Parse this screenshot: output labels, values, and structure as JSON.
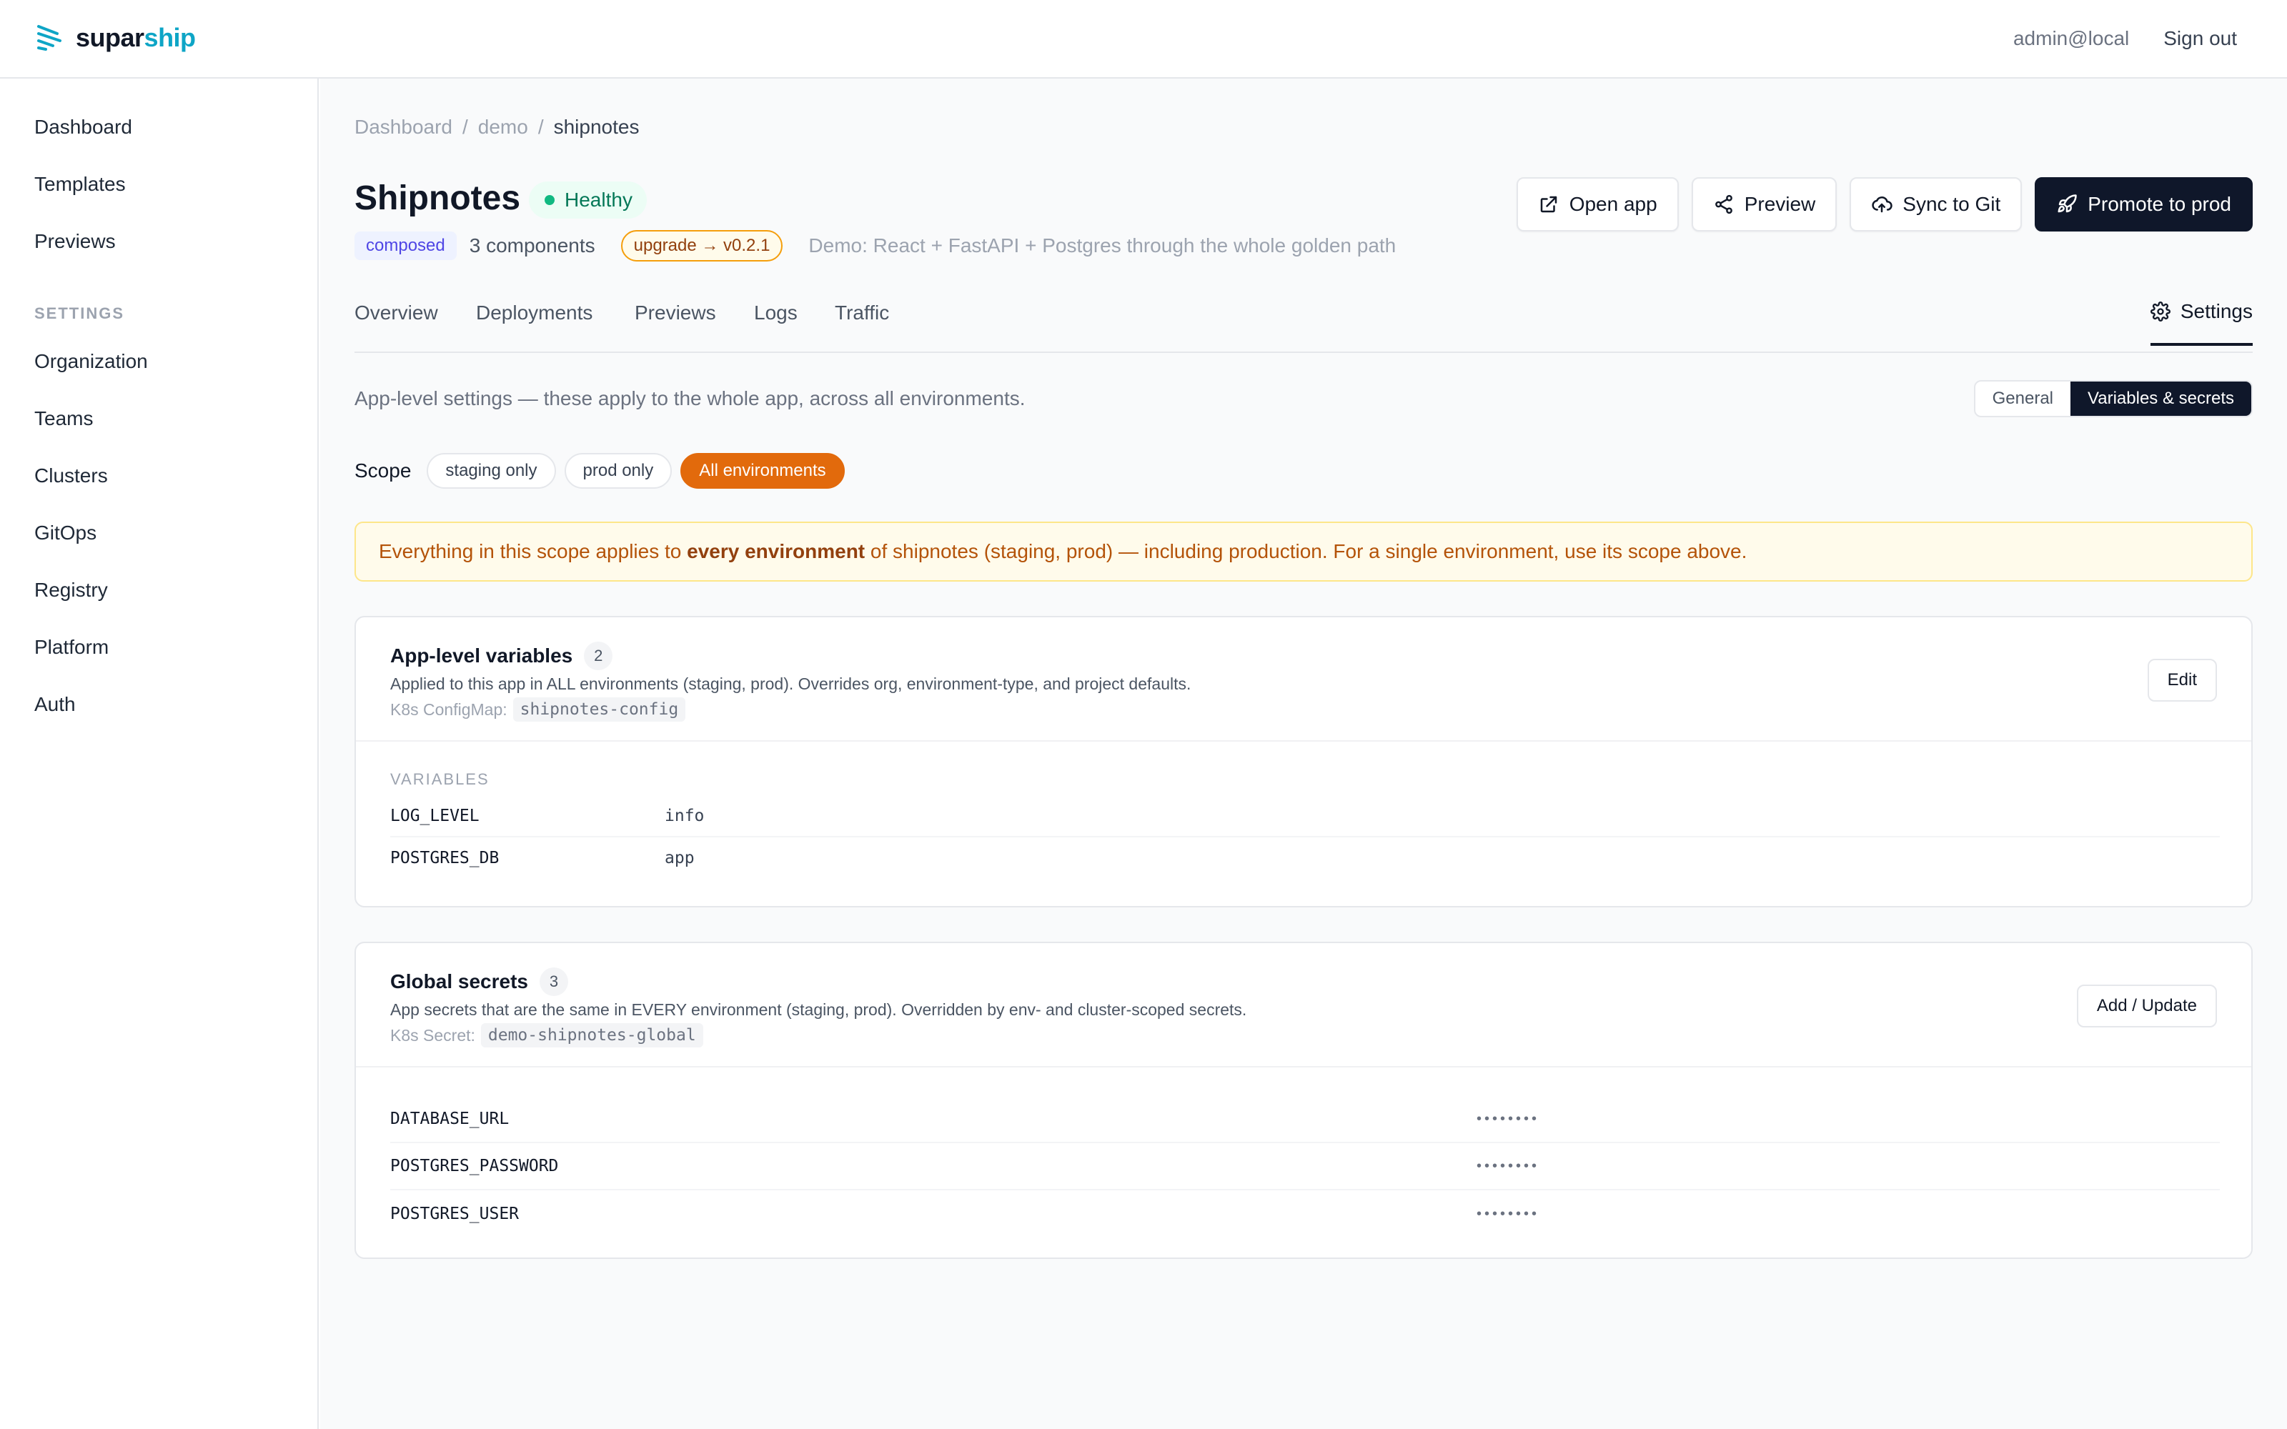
{
  "app": {
    "brand_prefix": "supar",
    "brand_suffix": "ship",
    "user": "admin@local",
    "signout_label": "Sign out"
  },
  "sidebar": {
    "items": [
      "Dashboard",
      "Templates",
      "Previews"
    ],
    "settings_heading": "SETTINGS",
    "settings_items": [
      "Organization",
      "Teams",
      "Clusters",
      "GitOps",
      "Registry",
      "Platform",
      "Auth"
    ]
  },
  "breadcrumb": [
    "Dashboard",
    "demo",
    "shipnotes"
  ],
  "page": {
    "title": "Shipnotes",
    "health": "Healthy",
    "tag": "composed",
    "components": "3 components",
    "upgrade": "upgrade → v0.2.1",
    "description": "Demo: React + FastAPI + Postgres through the whole golden path"
  },
  "actions": {
    "open_app": "Open app",
    "preview": "Preview",
    "sync": "Sync to Git",
    "promote": "Promote to prod"
  },
  "tabs": [
    "Overview",
    "Deployments",
    "Previews",
    "Logs",
    "Traffic"
  ],
  "active_tab": "Settings",
  "settings": {
    "intro": "App-level settings — these apply to the whole app, across all environments.",
    "segments": [
      "General",
      "Variables & secrets"
    ],
    "active_segment": "Variables & secrets",
    "scope_label": "Scope",
    "scopes": [
      "staging only",
      "prod only",
      "All environments"
    ],
    "active_scope": "All environments",
    "warning_pre": "Everything in this scope applies to ",
    "warning_bold": "every environment",
    "warning_post": " of shipnotes (staging, prod) — including production. For a single environment, use its scope above."
  },
  "variables_card": {
    "title": "App-level variables",
    "count": "2",
    "subtitle": "Applied to this app in ALL environments (staging, prod). Overrides org, environment-type, and project defaults.",
    "resource_label": "K8s ConfigMap:",
    "resource_name": "shipnotes-config",
    "button": "Edit",
    "section_label": "VARIABLES",
    "rows": [
      {
        "key": "LOG_LEVEL",
        "value": "info"
      },
      {
        "key": "POSTGRES_DB",
        "value": "app"
      }
    ]
  },
  "secrets_card": {
    "title": "Global secrets",
    "count": "3",
    "subtitle": "App secrets that are the same in EVERY environment (staging, prod). Overridden by env- and cluster-scoped secrets.",
    "resource_label": "K8s Secret:",
    "resource_name": "demo-shipnotes-global",
    "button": "Add / Update",
    "rows": [
      {
        "key": "DATABASE_URL",
        "value": "••••••••"
      },
      {
        "key": "POSTGRES_PASSWORD",
        "value": "••••••••"
      },
      {
        "key": "POSTGRES_USER",
        "value": "••••••••"
      }
    ]
  },
  "colors": {
    "accent": "#0ea5c6",
    "primary_dark": "#0f172a",
    "scope_active": "#e26a0c",
    "healthy": "#10b981",
    "warning_bg": "#fffbeb"
  },
  "icons": [
    "logo-icon",
    "external-link-icon",
    "share-icon",
    "cloud-upload-icon",
    "rocket-icon",
    "gear-icon"
  ]
}
